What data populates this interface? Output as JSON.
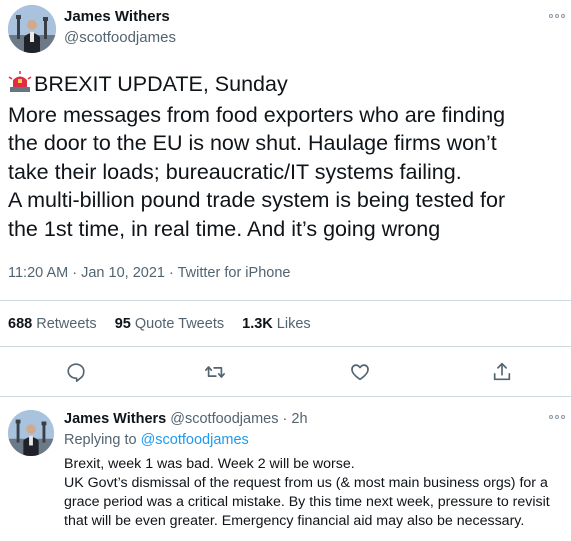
{
  "main_tweet": {
    "author_name": "James Withers",
    "author_handle": "@scotfoodjames",
    "siren_icon": "police-car-light-emoji",
    "body_lines": [
      "BREXIT UPDATE, Sunday",
      "More messages from food exporters who are finding",
      "the door to the EU is now shut. Haulage firms won’t",
      "take their loads; bureaucratic/IT systems failing.",
      "A multi-billion pound trade system is being tested for",
      "the 1st time, in real time. And it’s going wrong"
    ],
    "time": "11:20 AM",
    "date": "Jan 10, 2021",
    "source": "Twitter for iPhone",
    "meta_separator": "·"
  },
  "stats": {
    "retweets_count": "688",
    "retweets_label": "Retweets",
    "quotes_count": "95",
    "quotes_label": "Quote Tweets",
    "likes_count": "1.3K",
    "likes_label": "Likes"
  },
  "actions": [
    "reply-icon",
    "retweet-icon",
    "like-icon",
    "share-icon"
  ],
  "reply_tweet": {
    "author_name": "James Withers",
    "author_handle": "@scotfoodjames",
    "separator": "·",
    "age": "2h",
    "replying_prefix": "Replying to",
    "replying_to": "@scotfoodjames",
    "body_lines": [
      "Brexit, week 1 was bad. Week 2 will be worse.",
      "UK Govt’s dismissal of the request from us (& most main business orgs) for a",
      "grace period was a critical mistake. By this time next week, pressure to revisit",
      "that will be even greater. Emergency financial aid may also be necessary."
    ]
  },
  "colors": {
    "text": "#0f1419",
    "muted": "#536471",
    "link": "#1d9bf0",
    "divider": "#cfd9de"
  }
}
